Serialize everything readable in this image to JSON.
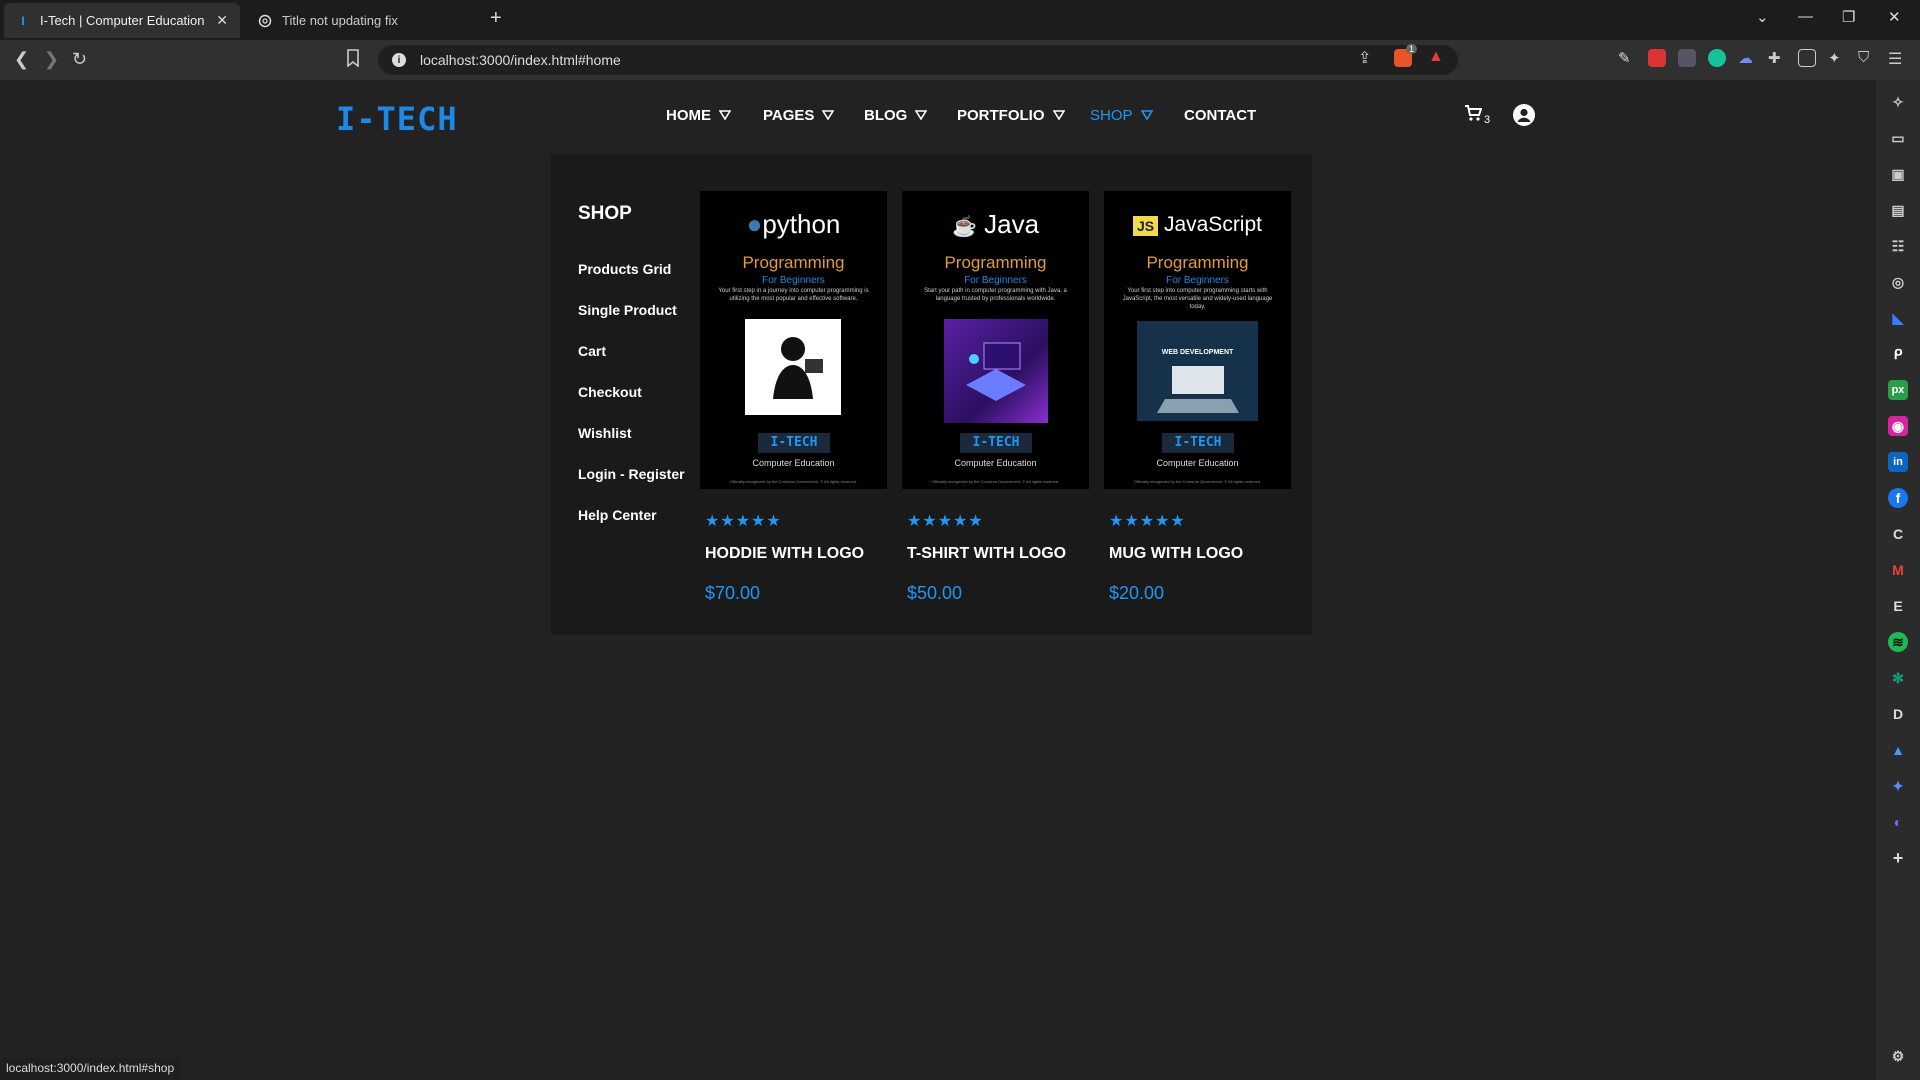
{
  "browser": {
    "tabs": [
      {
        "title": "I-Tech | Computer Education In",
        "favicon": "I",
        "active": true
      },
      {
        "title": "Title not updating fix",
        "favicon": "chatgpt-icon",
        "active": false
      }
    ],
    "url": "localhost:3000/index.html#home",
    "status_url": "localhost:3000/index.html#shop",
    "ext_badge": "1"
  },
  "site": {
    "logo": "I-TECH",
    "nav": [
      {
        "label": "HOME",
        "has_dropdown": true,
        "active": false
      },
      {
        "label": "PAGES",
        "has_dropdown": true,
        "active": false
      },
      {
        "label": "BLOG",
        "has_dropdown": true,
        "active": false
      },
      {
        "label": "PORTFOLIO",
        "has_dropdown": true,
        "active": false
      },
      {
        "label": "SHOP",
        "has_dropdown": true,
        "active": true
      },
      {
        "label": "CONTACT",
        "has_dropdown": false,
        "active": false
      }
    ],
    "cart_count": "3",
    "accent": "#2196f3"
  },
  "shop_menu": {
    "title": "SHOP",
    "links": [
      "Products Grid",
      "Single Product",
      "Cart",
      "Checkout",
      "Wishlist",
      "Login - Register",
      "Help Center"
    ],
    "products": [
      {
        "name": "HODDIE WITH LOGO",
        "price": "$70.00",
        "rating": 5,
        "cover": {
          "language": "python",
          "title": "Programming",
          "subtitle": "For Beginners",
          "desc": "Your first step in a journey into computer programming is utilizing the most popular and effective software.",
          "brand": "I-TECH",
          "brand_sub": "Computer Education",
          "foot": "Officially recognized by the Comoros Government. © All rights reserved."
        }
      },
      {
        "name": "T-SHIRT WITH LOGO",
        "price": "$50.00",
        "rating": 5,
        "cover": {
          "language": "Java",
          "title": "Programming",
          "subtitle": "For Beginners",
          "desc": "Start your path in computer programming with Java, a language trusted by professionals worldwide.",
          "brand": "I-TECH",
          "brand_sub": "Computer Education",
          "foot": "Officially recognized by the Comoros Government. © All rights reserved."
        }
      },
      {
        "name": "MUG WITH LOGO",
        "price": "$20.00",
        "rating": 5,
        "cover": {
          "language": "JavaScript",
          "title": "Programming",
          "subtitle": "For Beginners",
          "desc": "Your first step into computer programming starts with JavaScript, the most versatile and widely-used language today.",
          "brand": "I-TECH",
          "brand_sub": "Computer Education",
          "art_label": "WEB DEVELOPMENT",
          "foot": "Officially recognized by the Comoros Government. © All rights reserved."
        }
      }
    ]
  }
}
